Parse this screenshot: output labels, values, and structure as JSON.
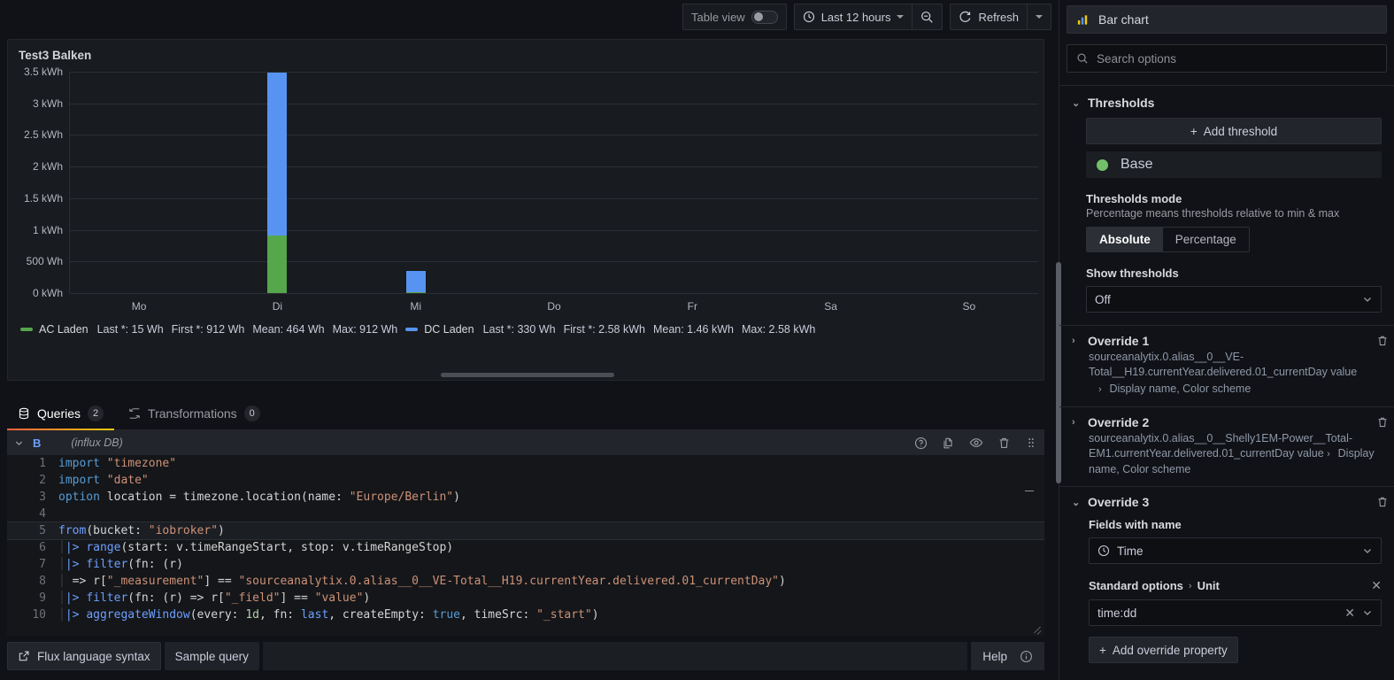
{
  "toolbar": {
    "table_view_label": "Table view",
    "table_view_on": false,
    "time_range_label": "Last 12 hours",
    "zoom_out_icon": "zoom-out-icon",
    "refresh_label": "Refresh"
  },
  "panel": {
    "title": "Test3 Balken"
  },
  "chart_data": {
    "type": "bar",
    "stacked": true,
    "title": "Test3 Balken",
    "xlabel": "",
    "ylabel": "",
    "categories": [
      "Mo",
      "Di",
      "Mi",
      "Do",
      "Fr",
      "Sa",
      "So"
    ],
    "ytick_labels": [
      "3.5 kWh",
      "3 kWh",
      "2.5 kWh",
      "2 kWh",
      "1.5 kWh",
      "1 kWh",
      "500 Wh",
      "0 kWh"
    ],
    "ytick_values": [
      3500,
      3000,
      2500,
      2000,
      1500,
      1000,
      500,
      0
    ],
    "yunit": "Wh",
    "ylim": [
      0,
      3500
    ],
    "grid": true,
    "legend_position": "bottom",
    "series": [
      {
        "name": "AC Laden",
        "color": "#56A64B",
        "values": [
          0,
          912,
          15,
          0,
          0,
          0,
          0
        ],
        "stats": {
          "last": "Last *: 15 Wh",
          "first": "First *: 912 Wh",
          "mean": "Mean: 464 Wh",
          "max": "Max: 912 Wh"
        }
      },
      {
        "name": "DC Laden",
        "color": "#5794F2",
        "values": [
          0,
          2580,
          330,
          0,
          0,
          0,
          0
        ],
        "stats": {
          "last": "Last *: 330 Wh",
          "first": "First *: 2.58 kWh",
          "mean": "Mean: 1.46 kWh",
          "max": "Max: 2.58 kWh"
        }
      }
    ]
  },
  "query_tabs": {
    "queries_label": "Queries",
    "queries_count": "2",
    "transformations_label": "Transformations",
    "transformations_count": "0"
  },
  "query_row": {
    "letter": "B",
    "datasource": "(influx DB)",
    "icons": [
      "help-icon",
      "duplicate-icon",
      "eye-icon",
      "trash-icon",
      "drag-handle-icon"
    ]
  },
  "editor": {
    "lines": [
      {
        "n": "1",
        "tokens": [
          {
            "t": "import ",
            "c": "kw"
          },
          {
            "t": "\"timezone\"",
            "c": "str"
          }
        ]
      },
      {
        "n": "2",
        "tokens": [
          {
            "t": "import ",
            "c": "kw"
          },
          {
            "t": "\"date\"",
            "c": "str"
          }
        ]
      },
      {
        "n": "3",
        "tokens": [
          {
            "t": "option",
            "c": "kw"
          },
          {
            "t": " location = timezone.location(name: ",
            "c": "plain"
          },
          {
            "t": "\"Europe/Berlin\"",
            "c": "str"
          },
          {
            "t": ")",
            "c": "plain"
          }
        ]
      },
      {
        "n": "4",
        "tokens": []
      },
      {
        "n": "5",
        "highlight": true,
        "tokens": [
          {
            "t": "from",
            "c": "fn"
          },
          {
            "t": "(bucket: ",
            "c": "plain"
          },
          {
            "t": "\"iobroker\"",
            "c": "str"
          },
          {
            "t": ")",
            "c": "plain"
          }
        ]
      },
      {
        "n": "6",
        "tokens": [
          {
            "t": "|> ",
            "c": "pipe"
          },
          {
            "t": "range",
            "c": "fn"
          },
          {
            "t": "(start: v.timeRangeStart, stop: v.timeRangeStop)",
            "c": "plain"
          }
        ]
      },
      {
        "n": "7",
        "tokens": [
          {
            "t": "|> ",
            "c": "pipe"
          },
          {
            "t": "filter",
            "c": "fn"
          },
          {
            "t": "(fn: (r)",
            "c": "plain"
          }
        ]
      },
      {
        "n": "8",
        "tokens": [
          {
            "t": " => r[",
            "c": "plain"
          },
          {
            "t": "\"_measurement\"",
            "c": "str"
          },
          {
            "t": "] == ",
            "c": "plain"
          },
          {
            "t": "\"sourceanalytix.0.alias__0__VE-Total__H19.currentYear.delivered.01_currentDay\"",
            "c": "str"
          },
          {
            "t": ")",
            "c": "plain"
          }
        ]
      },
      {
        "n": "9",
        "tokens": [
          {
            "t": "|> ",
            "c": "pipe"
          },
          {
            "t": "filter",
            "c": "fn"
          },
          {
            "t": "(fn: (r) => r[",
            "c": "plain"
          },
          {
            "t": "\"_field\"",
            "c": "str"
          },
          {
            "t": "] == ",
            "c": "plain"
          },
          {
            "t": "\"value\"",
            "c": "str"
          },
          {
            "t": ")",
            "c": "plain"
          }
        ]
      },
      {
        "n": "10",
        "tokens": [
          {
            "t": "|> ",
            "c": "pipe"
          },
          {
            "t": "aggregateWindow",
            "c": "fn"
          },
          {
            "t": "(every: ",
            "c": "plain"
          },
          {
            "t": "1d",
            "c": "num"
          },
          {
            "t": ", fn: ",
            "c": "plain"
          },
          {
            "t": "last",
            "c": "fn"
          },
          {
            "t": ", createEmpty: ",
            "c": "plain"
          },
          {
            "t": "true",
            "c": "kw"
          },
          {
            "t": ", timeSrc: ",
            "c": "plain"
          },
          {
            "t": "\"_start\"",
            "c": "str"
          },
          {
            "t": ")",
            "c": "plain"
          }
        ]
      }
    ]
  },
  "query_bottom": {
    "flux_syntax_label": "Flux language syntax",
    "sample_query_label": "Sample query",
    "help_label": "Help"
  },
  "sidebar": {
    "viz_picker_label": "Bar chart",
    "viz_picker_icon": "bar-chart-icon",
    "search_placeholder": "Search options",
    "thresholds": {
      "section_label": "Thresholds",
      "add_threshold_label": "Add threshold",
      "base_label": "Base",
      "base_color": "#73BF69",
      "mode_label": "Thresholds mode",
      "mode_desc": "Percentage means thresholds relative to min & max",
      "mode_absolute": "Absolute",
      "mode_percentage": "Percentage",
      "mode_selected": "Absolute",
      "show_label": "Show thresholds",
      "show_value": "Off"
    },
    "overrides": [
      {
        "title": "Override 1",
        "matcher": "sourceanalytix.0.alias__0__VE-Total__H19.currentYear.delivered.01_currentDay value",
        "properties_summary": "Display name, Color scheme",
        "expanded": false
      },
      {
        "title": "Override 2",
        "matcher": "sourceanalytix.0.alias__0__Shelly1EM-Power__Total-EM1.currentYear.delivered.01_currentDay value",
        "properties_summary": "Display name, Color scheme",
        "expanded": false
      }
    ],
    "override3": {
      "title": "Override 3",
      "fields_label": "Fields with name",
      "fields_value": "Time",
      "fields_icon": "clock-icon",
      "std_options_label": "Standard options",
      "std_options_sub": "Unit",
      "unit_value": "time:dd",
      "add_property_label": "Add override property"
    }
  }
}
